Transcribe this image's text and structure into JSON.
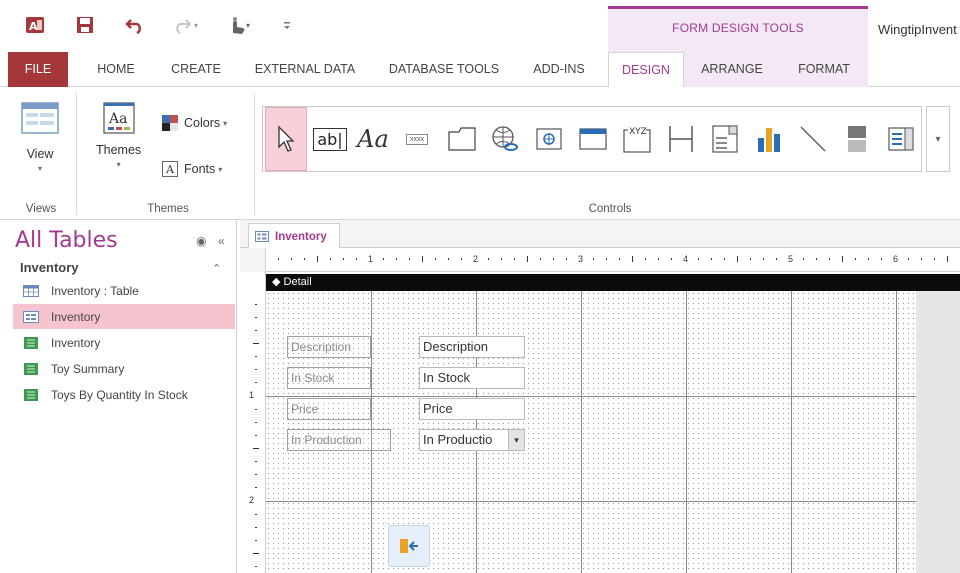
{
  "title_bar": {
    "contextual_label": "FORM DESIGN TOOLS",
    "app_title": "WingtipInvent",
    "qat_icons": [
      "access-logo-icon",
      "save-icon",
      "undo-icon",
      "redo-icon",
      "touch-mode-icon",
      "customize-qat-icon"
    ]
  },
  "tabs": {
    "file": "FILE",
    "home": "HOME",
    "create": "CREATE",
    "external_data": "EXTERNAL DATA",
    "database_tools": "DATABASE TOOLS",
    "add_ins": "ADD-INS",
    "design": "DESIGN",
    "arrange": "ARRANGE",
    "format": "FORMAT"
  },
  "ribbon": {
    "views": {
      "view_label": "View",
      "group_label": "Views"
    },
    "themes": {
      "themes_label": "Themes",
      "colors_label": "Colors",
      "fonts_label": "Fonts",
      "group_label": "Themes"
    },
    "controls": {
      "group_label": "Controls",
      "textbox_icon_text": "ab|",
      "label_icon_text": "Aa",
      "button_icon_text": "xxxx",
      "option_group_icon_text": "XYZ",
      "items": [
        "select-pointer-icon",
        "textbox-icon",
        "label-icon",
        "button-icon",
        "tab-control-icon",
        "hyperlink-icon",
        "web-browser-icon",
        "navigation-control-icon",
        "option-group-icon",
        "page-break-icon",
        "combo-box-icon",
        "chart-icon",
        "line-icon",
        "toggle-button-icon",
        "list-box-icon"
      ]
    }
  },
  "nav_pane": {
    "title": "All Tables",
    "group": "Inventory",
    "items": [
      {
        "label": "Inventory : Table",
        "icon": "table-icon"
      },
      {
        "label": "Inventory",
        "icon": "form-icon"
      },
      {
        "label": "Inventory",
        "icon": "report-icon"
      },
      {
        "label": "Toy Summary",
        "icon": "report-icon"
      },
      {
        "label": "Toys By Quantity In Stock",
        "icon": "report-icon"
      }
    ]
  },
  "document": {
    "tab_label": "Inventory",
    "section_label": "Detail",
    "ruler_numbers": [
      "1",
      "2",
      "3",
      "4",
      "5",
      "6"
    ],
    "vruler_numbers": [
      "1",
      "2"
    ],
    "fields": [
      {
        "label": "Description",
        "control": "Description"
      },
      {
        "label": "In Stock",
        "control": "In Stock"
      },
      {
        "label": "Price",
        "control": "Price"
      },
      {
        "label": "In Production",
        "control": "In Productio"
      }
    ],
    "combo_arrow": "▾"
  },
  "colors": {
    "accent": "#a33a92",
    "file_tab": "#a4373a",
    "selection": "#f6c4cf",
    "section_bar": "#0c0c0c"
  }
}
